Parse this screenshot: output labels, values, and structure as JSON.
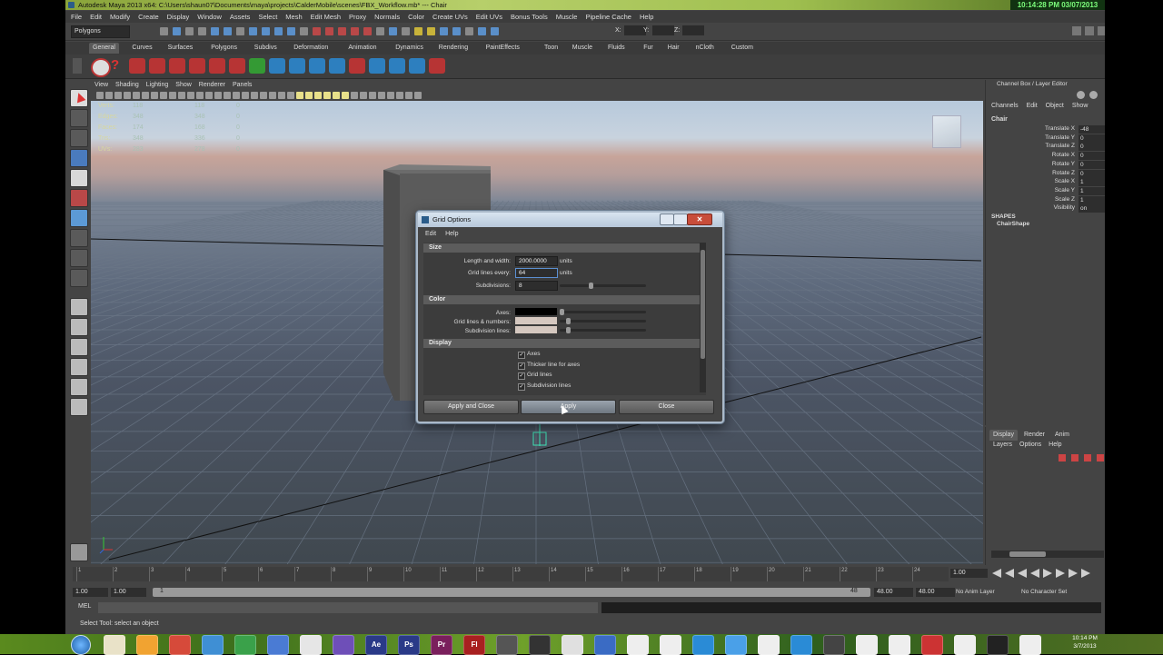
{
  "window": {
    "title": "Autodesk Maya 2013 x64: C:\\Users\\shaun07\\Documents\\maya\\projects\\CalderMobile\\scenes\\FBX_Workflow.mb*  ---  Chair",
    "clock": "10:14:28 PM 03/07/2013"
  },
  "menubar": [
    "File",
    "Edit",
    "Modify",
    "Create",
    "Display",
    "Window",
    "Assets",
    "Select",
    "Mesh",
    "Edit Mesh",
    "Proxy",
    "Normals",
    "Color",
    "Create UVs",
    "Edit UVs",
    "Bonus Tools",
    "Muscle",
    "Pipeline Cache",
    "Help"
  ],
  "status": {
    "mode": "Polygons",
    "x_label": "X:",
    "y_label": "Y:",
    "z_label": "Z:"
  },
  "shelf_tabs": [
    "General",
    "Curves",
    "Surfaces",
    "Polygons",
    "Subdivs",
    "Deformation",
    "Animation",
    "Dynamics",
    "Rendering",
    "PaintEffects",
    "Toon",
    "Muscle",
    "Fluids",
    "Fur",
    "Hair",
    "nCloth",
    "Custom"
  ],
  "panel_menu": [
    "View",
    "Shading",
    "Lighting",
    "Show",
    "Renderer",
    "Panels"
  ],
  "hud": {
    "rows": [
      {
        "label": "Verts:",
        "a": "118",
        "b": "118",
        "c": "0"
      },
      {
        "label": "Edges:",
        "a": "348",
        "b": "348",
        "c": "0"
      },
      {
        "label": "Faces:",
        "a": "174",
        "b": "168",
        "c": "0"
      },
      {
        "label": "Tris:",
        "a": "348",
        "b": "336",
        "c": "0"
      },
      {
        "label": "UVs:",
        "a": "283",
        "b": "278",
        "c": "0"
      }
    ]
  },
  "channel_box": {
    "title": "Channel Box / Layer Editor",
    "menu": [
      "Channels",
      "Edit",
      "Object",
      "Show"
    ],
    "object": "Chair",
    "channels": [
      {
        "name": "Translate X",
        "value": "-48"
      },
      {
        "name": "Translate Y",
        "value": "0"
      },
      {
        "name": "Translate Z",
        "value": "0"
      },
      {
        "name": "Rotate X",
        "value": "0"
      },
      {
        "name": "Rotate Y",
        "value": "0"
      },
      {
        "name": "Rotate Z",
        "value": "0"
      },
      {
        "name": "Scale X",
        "value": "1"
      },
      {
        "name": "Scale Y",
        "value": "1"
      },
      {
        "name": "Scale Z",
        "value": "1"
      },
      {
        "name": "Visibility",
        "value": "on"
      }
    ],
    "shapes_header": "SHAPES",
    "shape": "ChairShape"
  },
  "layer_editor": {
    "tabs": [
      "Display",
      "Render",
      "Anim"
    ],
    "menu": [
      "Layers",
      "Options",
      "Help"
    ]
  },
  "dialog": {
    "title": "Grid Options",
    "menu": [
      "Edit",
      "Help"
    ],
    "size_section": "Size",
    "length_label": "Length and width:",
    "length_value": "2000.0000",
    "units1": "units",
    "gridlines_label": "Grid lines every:",
    "gridlines_value": "64",
    "units2": "units",
    "subdivisions_label": "Subdivisions:",
    "subdivisions_value": "8",
    "color_section": "Color",
    "axes_label": "Axes:",
    "gridnum_label": "Grid lines & numbers:",
    "subdivlines_label": "Subdivision lines:",
    "display_section": "Display",
    "checks": [
      "Axes",
      "Thicker line for axes",
      "Grid lines",
      "Subdivision lines"
    ],
    "buttons": [
      "Apply and Close",
      "Apply",
      "Close"
    ]
  },
  "timeline": {
    "ticks": [
      "1",
      "2",
      "3",
      "4",
      "5",
      "6",
      "7",
      "8",
      "9",
      "10",
      "11",
      "12",
      "13",
      "14",
      "15",
      "16",
      "17",
      "18",
      "19",
      "20",
      "21",
      "22",
      "23",
      "24"
    ],
    "current": "1.00",
    "range_start": "1.00",
    "range_start2": "1.00",
    "range_handle": "1",
    "range_end_handle": "48",
    "range_end": "48.00",
    "range_end2": "48.00",
    "anim_layer": "No Anim Layer",
    "char_set": "No Character Set"
  },
  "cmdline": {
    "label": "MEL"
  },
  "helpline": "Select Tool: select an object",
  "taskbar": {
    "time": "10:14 PM",
    "date": "3/7/2013",
    "apps": [
      "Ae",
      "Ps",
      "Pr",
      "Fl"
    ]
  }
}
